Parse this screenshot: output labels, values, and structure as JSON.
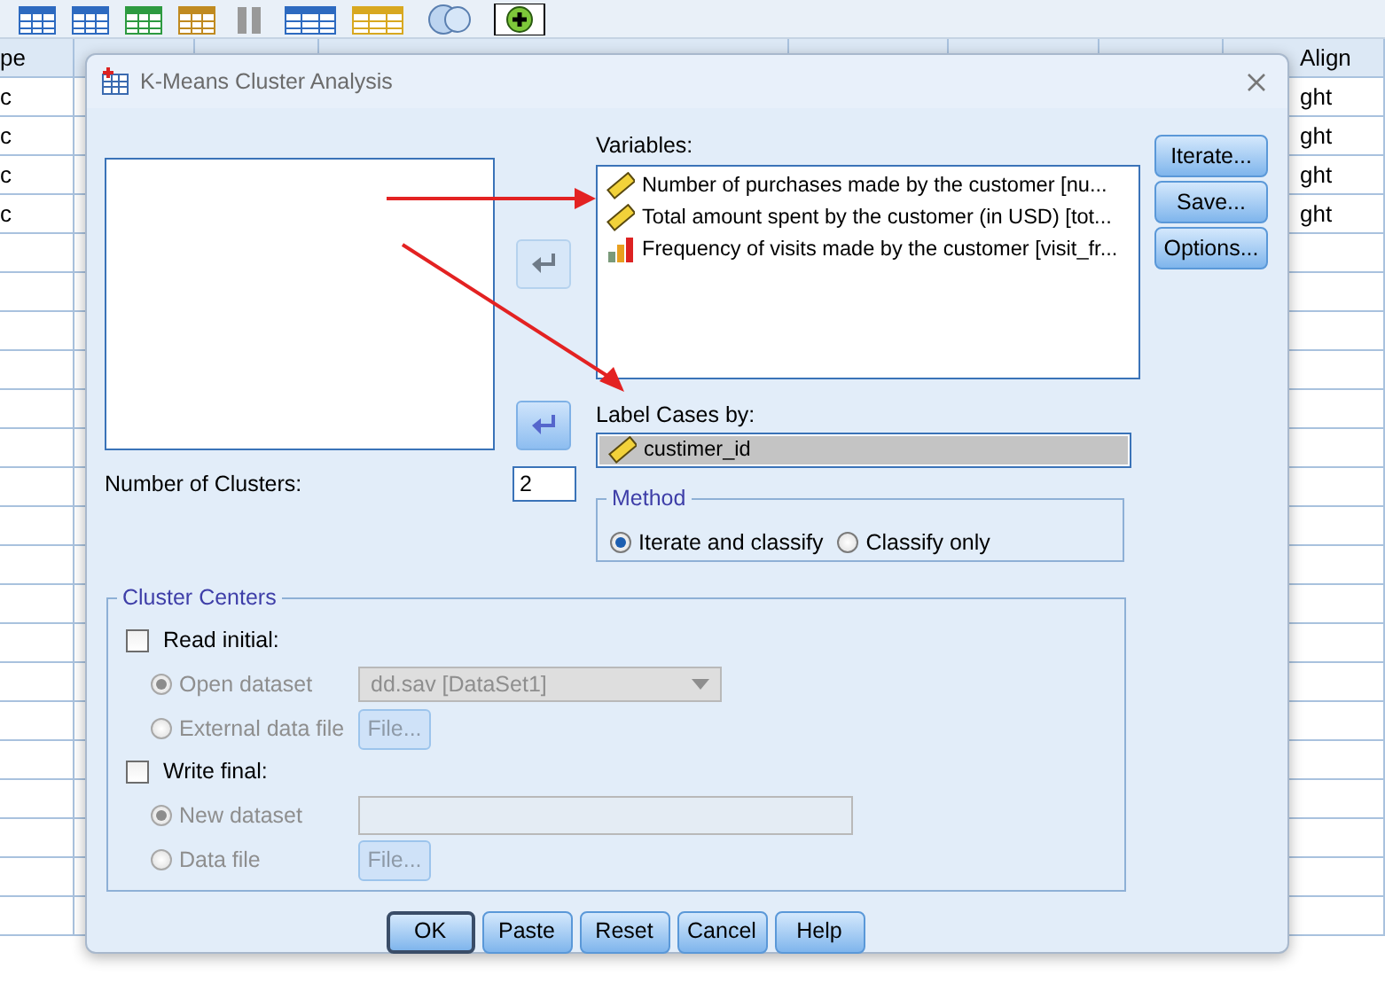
{
  "sheet": {
    "header_left": "pe",
    "header_right": "Align",
    "rows": [
      {
        "left": "c",
        "right": "ght"
      },
      {
        "left": "c",
        "right": "ght"
      },
      {
        "left": "c",
        "right": "ght"
      },
      {
        "left": "c",
        "right": "ght"
      }
    ]
  },
  "dialog": {
    "title": "K-Means Cluster Analysis",
    "variables_label": "Variables:",
    "variables": [
      {
        "name": "Number of purchases made by the customer [nu...",
        "kind": "scale"
      },
      {
        "name": "Total amount spent by the customer (in USD) [tot...",
        "kind": "scale"
      },
      {
        "name": "Frequency of visits made by the customer [visit_fr...",
        "kind": "ordinal"
      }
    ],
    "move_buttons": [
      {
        "disabled": true
      },
      {
        "disabled": false
      }
    ],
    "label_cases_label": "Label Cases by:",
    "label_case": {
      "name": "custimer_id",
      "kind": "scale"
    },
    "clusters_label": "Number of Clusters:",
    "clusters_value": "2",
    "method": {
      "legend": "Method",
      "options": [
        {
          "label": "Iterate and classify",
          "selected": true
        },
        {
          "label": "Classify only",
          "selected": false
        }
      ]
    },
    "side_buttons": [
      "Iterate...",
      "Save...",
      "Options..."
    ],
    "cluster_centers": {
      "legend": "Cluster Centers",
      "groups": [
        {
          "label": "Read initial:",
          "checked": false,
          "options": [
            {
              "label": "Open dataset",
              "selected": true,
              "disabled": true,
              "kind": "select",
              "value": "dd.sav [DataSet1]"
            },
            {
              "label": "External data file",
              "selected": false,
              "disabled": true,
              "kind": "button",
              "value": "File..."
            }
          ]
        },
        {
          "label": "Write final:",
          "checked": false,
          "options": [
            {
              "label": "New dataset",
              "selected": true,
              "disabled": true,
              "kind": "field"
            },
            {
              "label": "Data file",
              "selected": false,
              "disabled": true,
              "kind": "button",
              "value": "File..."
            }
          ]
        }
      ]
    },
    "buttons": [
      {
        "label": "OK",
        "default": true
      },
      {
        "label": "Paste",
        "default": false
      },
      {
        "label": "Reset",
        "default": false
      },
      {
        "label": "Cancel",
        "default": false
      },
      {
        "label": "Help",
        "default": false
      }
    ]
  }
}
